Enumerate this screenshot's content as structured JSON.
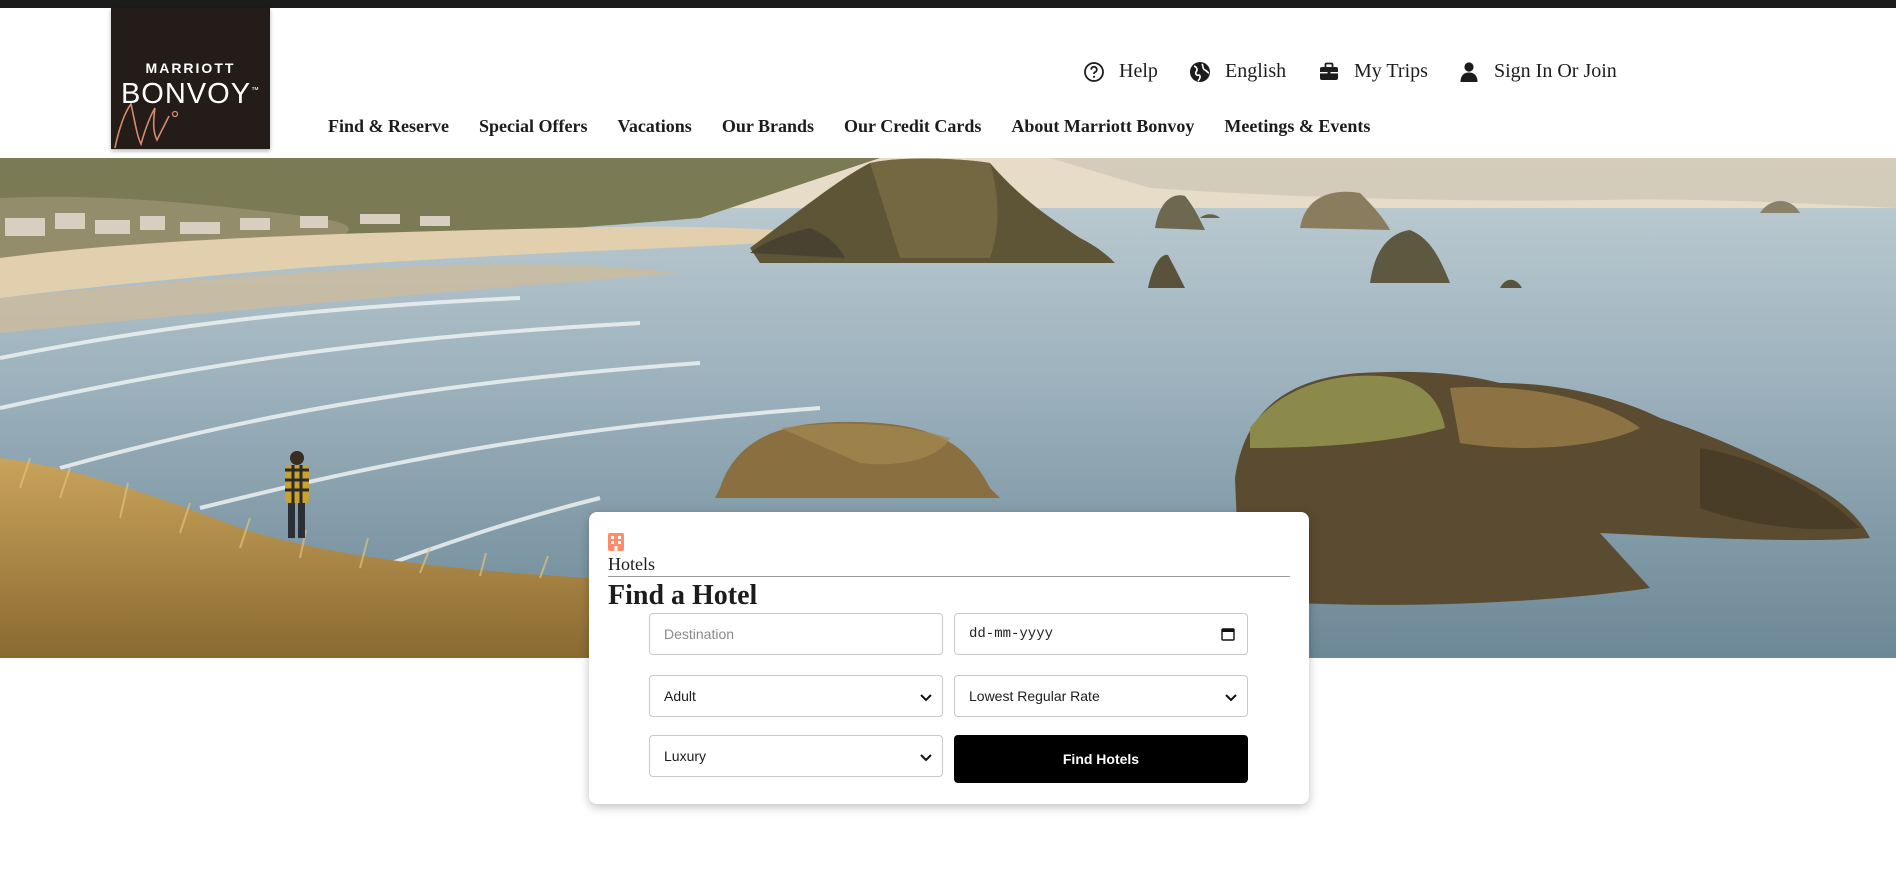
{
  "brand": {
    "line1": "MARRIOTT",
    "line2": "BONVOY",
    "tm": "™"
  },
  "utility_nav": [
    {
      "label": "Help",
      "icon": "help-circle-icon"
    },
    {
      "label": "English",
      "icon": "globe-icon"
    },
    {
      "label": "My Trips",
      "icon": "briefcase-icon"
    },
    {
      "label": "Sign In Or Join",
      "icon": "user-icon"
    }
  ],
  "main_nav": [
    "Find & Reserve",
    "Special Offers",
    "Vacations",
    "Our Brands",
    "Our Credit Cards",
    "About Marriott Bonvoy",
    "Meetings & Events"
  ],
  "search": {
    "tab_label": "Hotels",
    "title": "Find a Hotel",
    "destination_placeholder": "Destination",
    "date_placeholder": "dd-mm-yyyy",
    "guests_selected": "Adult",
    "rate_selected": "Lowest Regular Rate",
    "brand_selected": "Luxury",
    "submit_label": "Find Hotels"
  },
  "colors": {
    "accent": "#ff8d6b",
    "dark": "#1c1c1c",
    "button": "#000000"
  }
}
